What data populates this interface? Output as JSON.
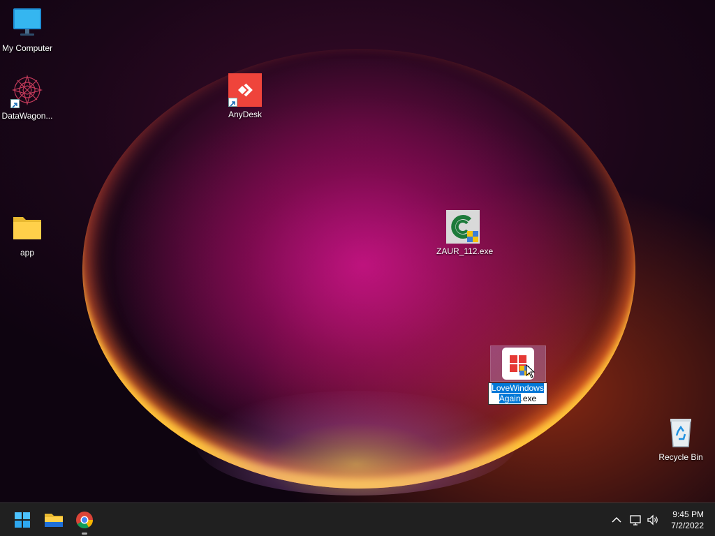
{
  "desktop": {
    "icons": {
      "my_computer": "My Computer",
      "datawagon": "DataWagon...",
      "anydesk": "AnyDesk",
      "app": "app",
      "zaur": "ZAUR_112.exe",
      "recycle_bin": "Recycle Bin"
    },
    "renaming": {
      "selected_part_1": "LoveWindows",
      "selected_part_2": "Again",
      "unselected_part": ".exe"
    }
  },
  "taskbar": {
    "time": "9:45 PM",
    "date": "7/2/2022",
    "pinned_icons": [
      "windows-start-icon",
      "file-explorer-icon",
      "chrome-icon"
    ]
  },
  "colors": {
    "accent": "#0078d7",
    "anydesk_red": "#ef443b",
    "taskbar": "#202020"
  }
}
